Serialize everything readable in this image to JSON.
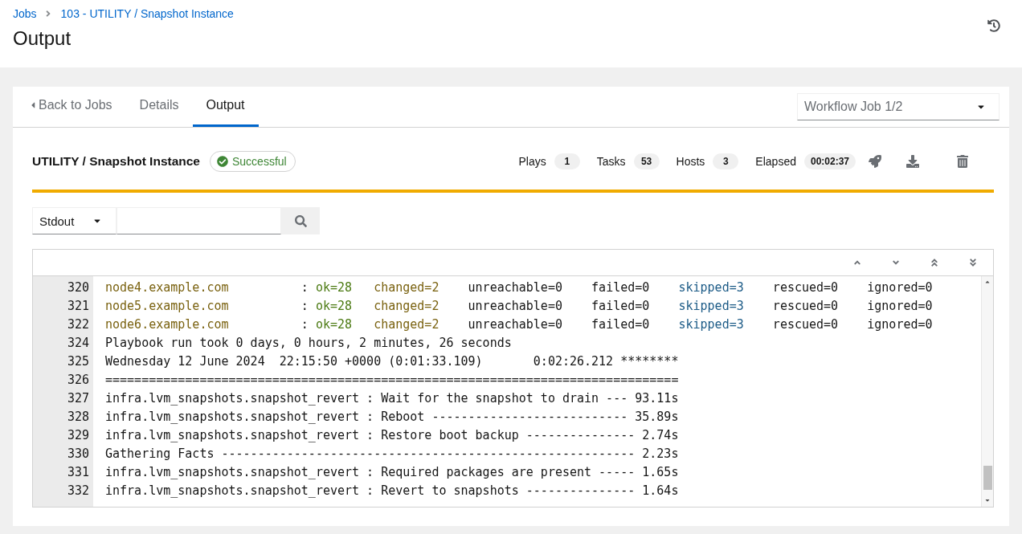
{
  "breadcrumb": [
    {
      "label": "Jobs"
    },
    {
      "label": "103 - UTILITY / Snapshot Instance"
    }
  ],
  "page_title": "Output",
  "tabs": [
    {
      "label": "Back to Jobs",
      "kind": "back",
      "selected": false
    },
    {
      "label": "Details",
      "kind": "tab",
      "selected": false
    },
    {
      "label": "Output",
      "kind": "tab",
      "selected": true
    }
  ],
  "workflow_select": {
    "value": "Workflow Job 1/2"
  },
  "job": {
    "title": "UTILITY / Snapshot Instance",
    "status": {
      "label": "Successful",
      "kind": "success"
    }
  },
  "stats": [
    {
      "label": "Plays",
      "value": "1"
    },
    {
      "label": "Tasks",
      "value": "53"
    },
    {
      "label": "Hosts",
      "value": "3"
    },
    {
      "label": "Elapsed",
      "value": "00:02:37"
    }
  ],
  "output_filter": {
    "stream": "Stdout"
  },
  "output": {
    "lines": [
      {
        "number": "320",
        "segments": [
          {
            "kind": "host",
            "text": "node4.example.com"
          },
          {
            "kind": "plain",
            "text": "          : "
          },
          {
            "kind": "ok",
            "text": "ok=28   "
          },
          {
            "kind": "changed",
            "text": "changed=2"
          },
          {
            "kind": "plain",
            "text": "    unreachable=0    failed=0    "
          },
          {
            "kind": "skipped",
            "text": "skipped=3"
          },
          {
            "kind": "plain",
            "text": "    rescued=0    ignored=0"
          }
        ]
      },
      {
        "number": "321",
        "segments": [
          {
            "kind": "host",
            "text": "node5.example.com"
          },
          {
            "kind": "plain",
            "text": "          : "
          },
          {
            "kind": "ok",
            "text": "ok=28   "
          },
          {
            "kind": "changed",
            "text": "changed=2"
          },
          {
            "kind": "plain",
            "text": "    unreachable=0    failed=0    "
          },
          {
            "kind": "skipped",
            "text": "skipped=3"
          },
          {
            "kind": "plain",
            "text": "    rescued=0    ignored=0"
          }
        ]
      },
      {
        "number": "322",
        "segments": [
          {
            "kind": "host",
            "text": "node6.example.com"
          },
          {
            "kind": "plain",
            "text": "          : "
          },
          {
            "kind": "ok",
            "text": "ok=28   "
          },
          {
            "kind": "changed",
            "text": "changed=2"
          },
          {
            "kind": "plain",
            "text": "    unreachable=0    failed=0    "
          },
          {
            "kind": "skipped",
            "text": "skipped=3"
          },
          {
            "kind": "plain",
            "text": "    rescued=0    ignored=0"
          }
        ]
      },
      {
        "number": "324",
        "segments": [
          {
            "kind": "plain",
            "text": "Playbook run took 0 days, 0 hours, 2 minutes, 26 seconds"
          }
        ]
      },
      {
        "number": "325",
        "segments": [
          {
            "kind": "plain",
            "text": "Wednesday 12 June 2024  22:15:50 +0000 (0:01:33.109)       0:02:26.212 ********"
          }
        ]
      },
      {
        "number": "326",
        "segments": [
          {
            "kind": "plain",
            "text": "==============================================================================="
          }
        ]
      },
      {
        "number": "327",
        "segments": [
          {
            "kind": "plain",
            "text": "infra.lvm_snapshots.snapshot_revert : Wait for the snapshot to drain --- 93.11s"
          }
        ]
      },
      {
        "number": "328",
        "segments": [
          {
            "kind": "plain",
            "text": "infra.lvm_snapshots.snapshot_revert : Reboot --------------------------- 35.89s"
          }
        ]
      },
      {
        "number": "329",
        "segments": [
          {
            "kind": "plain",
            "text": "infra.lvm_snapshots.snapshot_revert : Restore boot backup --------------- 2.74s"
          }
        ]
      },
      {
        "number": "330",
        "segments": [
          {
            "kind": "plain",
            "text": "Gathering Facts --------------------------------------------------------- 2.23s"
          }
        ]
      },
      {
        "number": "331",
        "segments": [
          {
            "kind": "plain",
            "text": "infra.lvm_snapshots.snapshot_revert : Required packages are present ----- 1.65s"
          }
        ]
      },
      {
        "number": "332",
        "segments": [
          {
            "kind": "plain",
            "text": "infra.lvm_snapshots.snapshot_revert : Revert to snapshots --------------- 1.64s"
          }
        ]
      }
    ]
  }
}
